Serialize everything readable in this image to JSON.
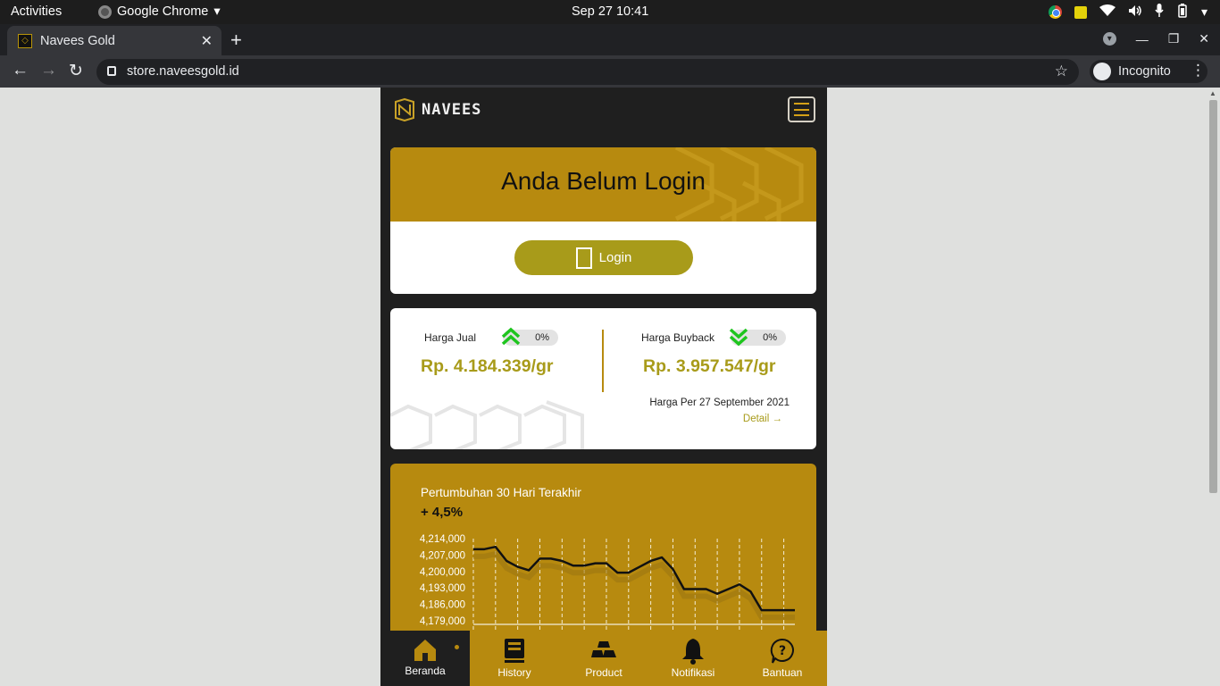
{
  "os": {
    "activities": "Activities",
    "app_name": "Google Chrome",
    "clock": "Sep 27  10:41"
  },
  "browser": {
    "tab_title": "Navees Gold",
    "url": "store.naveesgold.id",
    "incognito_label": "Incognito"
  },
  "app": {
    "brand": "NAVEES",
    "login_card": {
      "heading": "Anda Belum Login",
      "button_label": "Login"
    },
    "price_card": {
      "sell_label": "Harga Jual",
      "sell_change": "0%",
      "sell_price": "Rp. 4.184.339/gr",
      "buyback_label": "Harga Buyback",
      "buyback_change": "0%",
      "buyback_price": "Rp. 3.957.547/gr",
      "date_text": "Harga Per 27 September 2021",
      "detail_link": "Detail →"
    },
    "chart_card": {
      "title": "Pertumbuhan 30 Hari Terakhir",
      "growth": "+ 4,5%"
    },
    "bottom_nav": [
      {
        "label": "Beranda",
        "icon": "home-icon",
        "active": true
      },
      {
        "label": "History",
        "icon": "history-icon",
        "active": false
      },
      {
        "label": "Product",
        "icon": "gold-bars-icon",
        "active": false
      },
      {
        "label": "Notifikasi",
        "icon": "bell-icon",
        "active": false
      },
      {
        "label": "Bantuan",
        "icon": "help-icon",
        "active": false
      }
    ]
  },
  "colors": {
    "gold": "#b78a0f",
    "olive": "#a89b1a",
    "dark": "#1f1f1f",
    "up_green": "#1ec51e"
  },
  "chart_data": {
    "type": "line",
    "title": "Pertumbuhan 30 Hari Terakhir",
    "y_ticks": [
      "4,214,000",
      "4,207,000",
      "4,200,000",
      "4,193,000",
      "4,186,000",
      "4,179,000"
    ],
    "ylim": [
      4179000,
      4214000
    ],
    "grid": "vertical dashed",
    "values": [
      4209500,
      4209500,
      4210500,
      4204500,
      4202000,
      4200500,
      4205500,
      4205500,
      4204500,
      4202500,
      4202500,
      4203500,
      4203500,
      4199500,
      4199500,
      4202000,
      4204500,
      4206000,
      4201000,
      4192500,
      4192500,
      4192500,
      4190500,
      4192500,
      4194500,
      4191500,
      4183500,
      4183500,
      4183500,
      4183500
    ]
  }
}
